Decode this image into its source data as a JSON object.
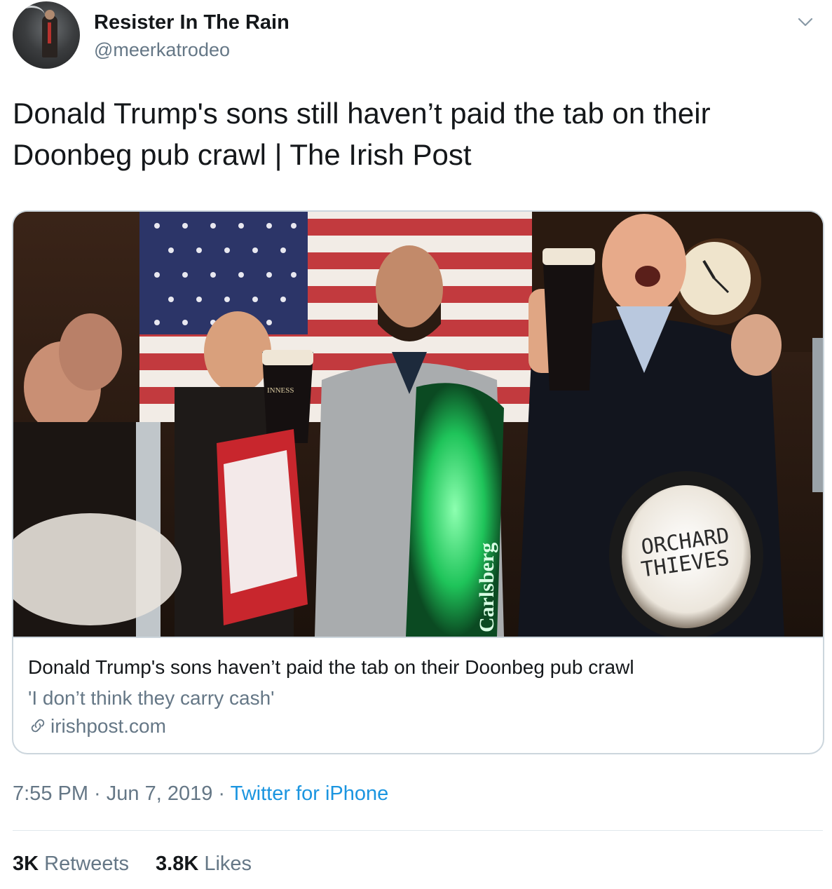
{
  "user": {
    "display_name": "Resister In The Rain",
    "handle": "@meerkatrodeo"
  },
  "tweet": {
    "text_line1": "Donald Trump's sons still haven’t paid the tab on their",
    "text_line2": "Doonbeg pub crawl | The Irish Post"
  },
  "card": {
    "image_signs": {
      "tap_top": "ORCHARD",
      "tap_bottom": "THIEVES",
      "glass_left": "INNESS",
      "tap_green": "Carlsberg"
    },
    "title": "Donald Trump's sons haven’t paid the tab on their Doonbeg pub crawl",
    "description": "'I don’t think they carry cash'",
    "domain": "irishpost.com",
    "link_icon": "link-icon"
  },
  "meta": {
    "time": "7:55 PM",
    "separator": " · ",
    "date": "Jun 7, 2019",
    "source": "Twitter for iPhone"
  },
  "stats": {
    "retweets_count": "3K",
    "retweets_label": "Retweets",
    "likes_count": "3.8K",
    "likes_label": "Likes"
  },
  "colors": {
    "text": "#14171a",
    "secondary": "#657786",
    "link": "#1b95e0",
    "border": "#ccd6dd"
  }
}
